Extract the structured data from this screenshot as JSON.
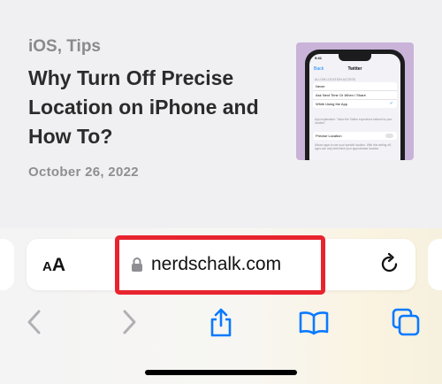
{
  "article": {
    "category": "iOS, Tips",
    "title": "Why Turn Off Precise Location on iPhone and How To?",
    "date": "October 26, 2022",
    "thumbnail": {
      "time": "9:41",
      "back_label": "Back",
      "screen_title": "Twitter",
      "section_header": "ALLOW LOCATION ACCESS",
      "options": [
        "Never",
        "Ask Next Time Or When I Share",
        "While Using the App"
      ],
      "selected_option": "While Using the App",
      "footnote": "App explanation: \"Allow the Twitter experience tailored to your location\"",
      "precise_label": "Precise Location",
      "precise_footnote": "Allows apps to use your specific location. With this setting off, apps can only determine your approximate location."
    }
  },
  "toolbar": {
    "text_size_label_small": "A",
    "text_size_label_large": "A",
    "url": "nerdschalk.com",
    "icons": {
      "lock": "lock-icon",
      "reload": "reload-icon",
      "back": "chevron-left-icon",
      "forward": "chevron-right-icon",
      "share": "share-icon",
      "bookmarks": "book-icon",
      "tabs": "tabs-icon"
    },
    "colors": {
      "accent": "#0a7aff",
      "disabled": "#b0b0b5",
      "highlight": "#e8242e"
    }
  }
}
